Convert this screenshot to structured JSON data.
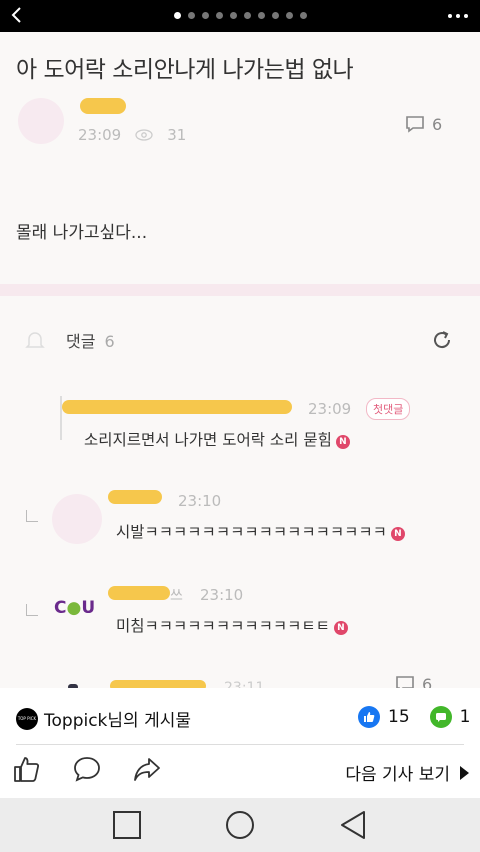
{
  "topbar": {
    "dot_count": 10,
    "active_dot": 0,
    "back_icon": "chevron-left-icon",
    "menu_icon": "more-horizontal-icon"
  },
  "post": {
    "title": "아 도어락 소리안나게 나가는법 없나",
    "time": "23:09",
    "views": "31",
    "comment_count": "6",
    "body": "몰래 나가고싶다..."
  },
  "comments": {
    "header": "댓글",
    "count": "6",
    "items": [
      {
        "time": "23:09",
        "badge": "첫댓글",
        "text": "소리지르면서 나가면 도어락 소리 묻힘",
        "new": "N"
      },
      {
        "time": "23:10",
        "text": "시발ㅋㅋㅋㅋㅋㅋㅋㅋㅋㅋㅋㅋㅋㅋㅋㅋㅋ",
        "new": "N"
      },
      {
        "name_tail": "쓰",
        "time": "23:10",
        "logo": "CU",
        "text": "미침ㅋㅋㅋㅋㅋㅋㅋㅋㅋㅋㅋㅌㅌ",
        "new": "N"
      },
      {
        "time": "23:11",
        "comment_count": "6"
      }
    ]
  },
  "footer": {
    "page_logo": "TOP PICK",
    "page_label": "Toppick님의 게시물",
    "likes": "15",
    "comments": "1",
    "next_label": "다음 기사 보기"
  },
  "colors": {
    "accent_like": "#1877f2",
    "accent_comment": "#42b72a",
    "redaction": "#f6c74c",
    "new_badge": "#e0476a"
  }
}
